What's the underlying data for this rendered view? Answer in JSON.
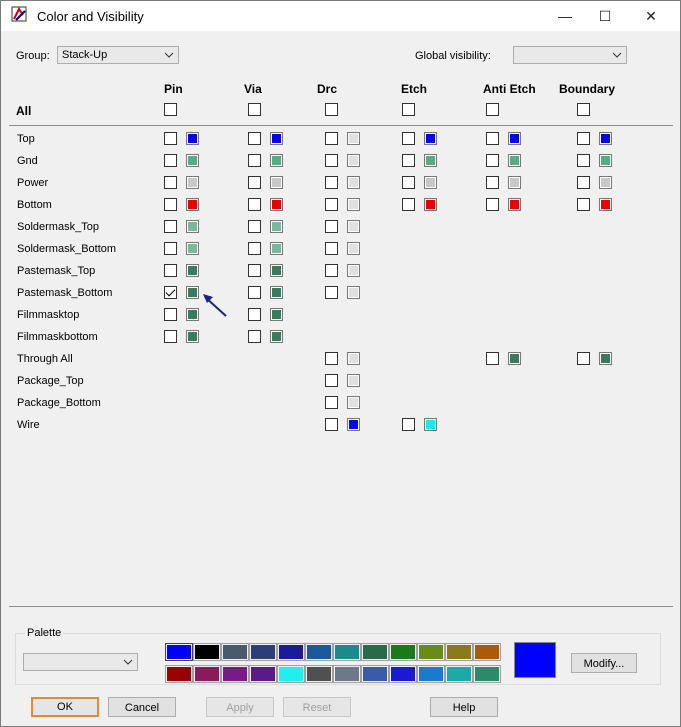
{
  "window": {
    "title": "Color and Visibility"
  },
  "titlebar_buttons": {
    "minimize": "—",
    "maximize": "☐",
    "close": "✕"
  },
  "group": {
    "label": "Group:",
    "value": "Stack-Up"
  },
  "global_visibility": {
    "label": "Global visibility:",
    "value": ""
  },
  "all_label": "All",
  "columns": [
    "Pin",
    "Via",
    "Drc",
    "Etch",
    "Anti Etch",
    "Boundary"
  ],
  "rows": [
    {
      "name": "Top",
      "cells": {
        "Pin": {
          "checked": false,
          "color": "#0000ff"
        },
        "Via": {
          "checked": false,
          "color": "#0000ff"
        },
        "Drc": {
          "checked": false,
          "color": "#e0e0e0"
        },
        "Etch": {
          "checked": false,
          "color": "#0000ff"
        },
        "Anti Etch": {
          "checked": false,
          "color": "#0000ff"
        },
        "Boundary": {
          "checked": false,
          "color": "#0000ff"
        }
      }
    },
    {
      "name": "Gnd",
      "cells": {
        "Pin": {
          "checked": false,
          "color": "#5aaa88"
        },
        "Via": {
          "checked": false,
          "color": "#5aaa88"
        },
        "Drc": {
          "checked": false,
          "color": "#e0e0e0"
        },
        "Etch": {
          "checked": false,
          "color": "#5aaa88"
        },
        "Anti Etch": {
          "checked": false,
          "color": "#5aaa88"
        },
        "Boundary": {
          "checked": false,
          "color": "#5aaa88"
        }
      }
    },
    {
      "name": "Power",
      "cells": {
        "Pin": {
          "checked": false,
          "color": "#c8c8c8"
        },
        "Via": {
          "checked": false,
          "color": "#c8c8c8"
        },
        "Drc": {
          "checked": false,
          "color": "#e0e0e0"
        },
        "Etch": {
          "checked": false,
          "color": "#c8c8c8"
        },
        "Anti Etch": {
          "checked": false,
          "color": "#c8c8c8"
        },
        "Boundary": {
          "checked": false,
          "color": "#c8c8c8"
        }
      }
    },
    {
      "name": "Bottom",
      "cells": {
        "Pin": {
          "checked": false,
          "color": "#ee0000"
        },
        "Via": {
          "checked": false,
          "color": "#ee0000"
        },
        "Drc": {
          "checked": false,
          "color": "#e0e0e0"
        },
        "Etch": {
          "checked": false,
          "color": "#ee0000"
        },
        "Anti Etch": {
          "checked": false,
          "color": "#ee0000"
        },
        "Boundary": {
          "checked": false,
          "color": "#ee0000"
        }
      }
    },
    {
      "name": "Soldermask_Top",
      "cells": {
        "Pin": {
          "checked": false,
          "color": "#7ab89e"
        },
        "Via": {
          "checked": false,
          "color": "#7ab89e"
        },
        "Drc": {
          "checked": false,
          "color": "#e0e0e0"
        }
      }
    },
    {
      "name": "Soldermask_Bottom",
      "cells": {
        "Pin": {
          "checked": false,
          "color": "#7ab89e"
        },
        "Via": {
          "checked": false,
          "color": "#7ab89e"
        },
        "Drc": {
          "checked": false,
          "color": "#e0e0e0"
        }
      }
    },
    {
      "name": "Pastemask_Top",
      "cells": {
        "Pin": {
          "checked": false,
          "color": "#3a7a5e"
        },
        "Via": {
          "checked": false,
          "color": "#3a7a5e"
        },
        "Drc": {
          "checked": false,
          "color": "#e0e0e0"
        }
      }
    },
    {
      "name": "Pastemask_Bottom",
      "cells": {
        "Pin": {
          "checked": true,
          "color": "#3a7a5e"
        },
        "Via": {
          "checked": false,
          "color": "#3a7a5e"
        },
        "Drc": {
          "checked": false,
          "color": "#e0e0e0"
        }
      }
    },
    {
      "name": "Filmmasktop",
      "cells": {
        "Pin": {
          "checked": false,
          "color": "#3a7a5e"
        },
        "Via": {
          "checked": false,
          "color": "#3a7a5e"
        }
      }
    },
    {
      "name": "Filmmaskbottom",
      "cells": {
        "Pin": {
          "checked": false,
          "color": "#3a7a5e"
        },
        "Via": {
          "checked": false,
          "color": "#3a7a5e"
        }
      }
    },
    {
      "name": "Through All",
      "cells": {
        "Drc": {
          "checked": false,
          "color": "#e0e0e0"
        },
        "Anti Etch": {
          "checked": false,
          "color": "#3a7a5e"
        },
        "Boundary": {
          "checked": false,
          "color": "#3a7a5e"
        }
      }
    },
    {
      "name": "Package_Top",
      "cells": {
        "Drc": {
          "checked": false,
          "color": "#e0e0e0"
        }
      }
    },
    {
      "name": "Package_Bottom",
      "cells": {
        "Drc": {
          "checked": false,
          "color": "#e0e0e0"
        }
      }
    },
    {
      "name": "Wire",
      "cells": {
        "Drc": {
          "checked": false,
          "color": "#0000ff"
        },
        "Etch": {
          "checked": false,
          "color": "#22e6e6"
        }
      }
    }
  ],
  "palette": {
    "label": "Palette",
    "combo_value": "",
    "row1": [
      "#0000ff",
      "#000000",
      "#4a5a6e",
      "#2c3e7a",
      "#1a1a9a",
      "#1a5a9a",
      "#1a8a8a",
      "#2a6a4a",
      "#1a7a1a",
      "#6a8a1a",
      "#8a7a1a",
      "#aa5a0a"
    ],
    "row2": [
      "#990000",
      "#8a1a5a",
      "#7a1a8a",
      "#5a1a8a",
      "#22eeee",
      "#505050",
      "#6a7a8a",
      "#3a5aaa",
      "#1a1ad0",
      "#1a7ad0",
      "#1aaaaa",
      "#2a8a6a"
    ],
    "selected_color": "#0000ff",
    "modify_label": "Modify..."
  },
  "buttons": {
    "ok": "OK",
    "cancel": "Cancel",
    "apply": "Apply",
    "reset": "Reset",
    "help": "Help"
  }
}
